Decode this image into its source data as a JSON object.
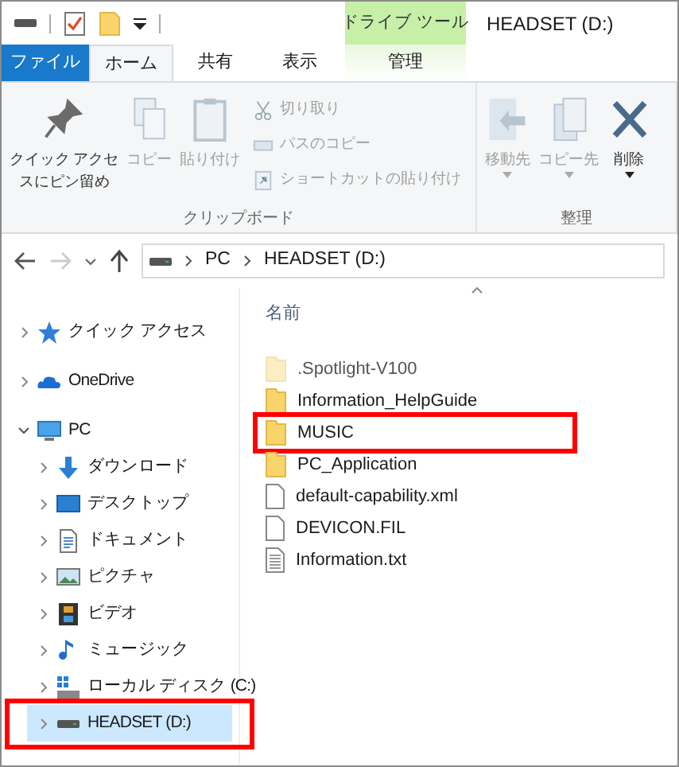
{
  "window": {
    "title": "HEADSET (D:)",
    "context_tab": "ドライブ ツール"
  },
  "tabs": [
    {
      "label": "ファイル",
      "kind": "file",
      "selected": false
    },
    {
      "label": "ホーム",
      "kind": "tab",
      "selected": true
    },
    {
      "label": "共有",
      "kind": "tab",
      "selected": false
    },
    {
      "label": "表示",
      "kind": "tab",
      "selected": false
    },
    {
      "label": "管理",
      "kind": "context",
      "selected": false
    }
  ],
  "ribbon": {
    "groups": [
      {
        "label": "クリップボード",
        "large": [
          {
            "lines": [
              "クイック アクセ",
              "スにピン留め"
            ],
            "kind": "pin",
            "disabled": false,
            "dropdown": false
          },
          {
            "lines": [
              "コピー"
            ],
            "kind": "copy",
            "disabled": true,
            "dropdown": false
          },
          {
            "lines": [
              "貼り付け"
            ],
            "kind": "paste",
            "disabled": true,
            "dropdown": false
          }
        ],
        "small": [
          {
            "label": "切り取り",
            "kind": "cut",
            "disabled": true
          },
          {
            "label": "パスのコピー",
            "kind": "path",
            "disabled": true
          },
          {
            "label": "ショートカットの貼り付け",
            "kind": "shortcut",
            "disabled": true
          }
        ]
      },
      {
        "label": "整理",
        "large": [
          {
            "lines": [
              "移動先"
            ],
            "kind": "move",
            "disabled": true,
            "dropdown": true
          },
          {
            "lines": [
              "コピー先"
            ],
            "kind": "copyto",
            "disabled": true,
            "dropdown": true
          },
          {
            "lines": [
              "削除"
            ],
            "kind": "delete",
            "disabled": false,
            "dropdown": true
          }
        ]
      }
    ]
  },
  "address": {
    "back_disabled": false,
    "forward_disabled": true,
    "crumbs": [
      "PC",
      "HEADSET (D:)"
    ]
  },
  "nav": [
    {
      "label": "クイック アクセス",
      "kind": "star",
      "expanded": false,
      "selected": false,
      "annotated": false
    },
    {
      "label": "OneDrive",
      "kind": "cloud",
      "expanded": false,
      "selected": false,
      "annotated": false
    },
    {
      "label": "PC",
      "kind": "pc",
      "expanded": true,
      "selected": false,
      "annotated": false,
      "children": [
        {
          "label": "ダウンロード",
          "kind": "download",
          "expanded": false,
          "selected": false,
          "annotated": false
        },
        {
          "label": "デスクトップ",
          "kind": "desktop",
          "expanded": false,
          "selected": false,
          "annotated": false
        },
        {
          "label": "ドキュメント",
          "kind": "document",
          "expanded": false,
          "selected": false,
          "annotated": false
        },
        {
          "label": "ピクチャ",
          "kind": "picture",
          "expanded": false,
          "selected": false,
          "annotated": false
        },
        {
          "label": "ビデオ",
          "kind": "video",
          "expanded": false,
          "selected": false,
          "annotated": false
        },
        {
          "label": "ミュージック",
          "kind": "music",
          "expanded": false,
          "selected": false,
          "annotated": false
        },
        {
          "label": "ローカル ディスク (C:)",
          "kind": "localdisk",
          "expanded": false,
          "selected": false,
          "annotated": false
        },
        {
          "label": "HEADSET (D:)",
          "kind": "drive",
          "expanded": false,
          "selected": true,
          "annotated": true
        }
      ]
    }
  ],
  "list": {
    "column": "名前",
    "files": [
      {
        "name": ".Spotlight-V100",
        "kind": "folder",
        "hidden": true,
        "annotated": false
      },
      {
        "name": "Information_HelpGuide",
        "kind": "folder",
        "hidden": false,
        "annotated": false
      },
      {
        "name": "MUSIC",
        "kind": "folder",
        "hidden": false,
        "annotated": true
      },
      {
        "name": "PC_Application",
        "kind": "folder",
        "hidden": false,
        "annotated": false
      },
      {
        "name": "default-capability.xml",
        "kind": "file",
        "hidden": false,
        "annotated": false
      },
      {
        "name": "DEVICON.FIL",
        "kind": "file",
        "hidden": false,
        "annotated": false
      },
      {
        "name": "Information.txt",
        "kind": "text",
        "hidden": false,
        "annotated": false
      }
    ]
  }
}
